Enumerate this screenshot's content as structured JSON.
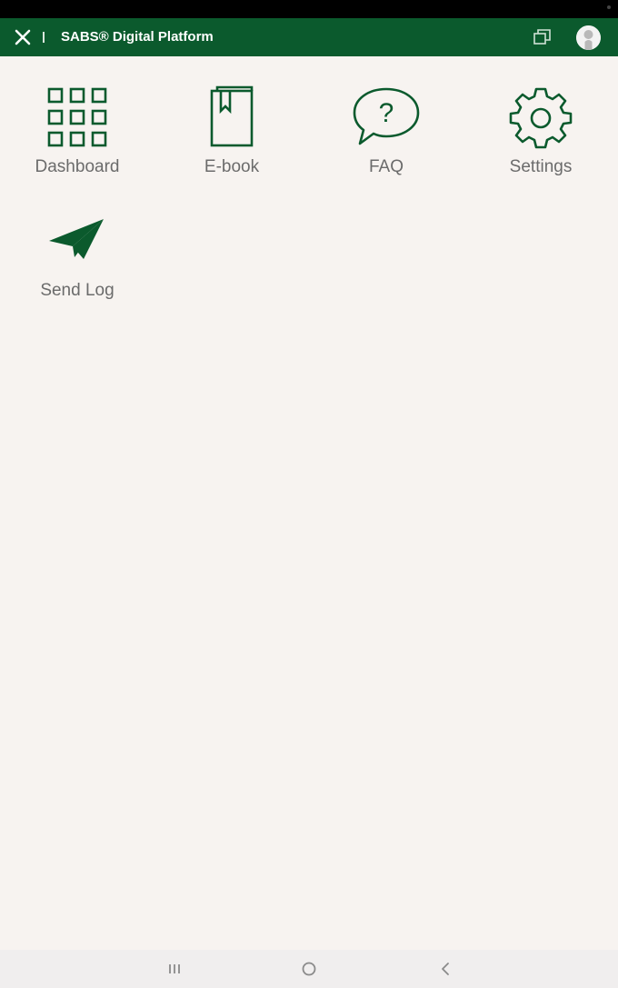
{
  "app_bar": {
    "title": "SABS® Digital Platform",
    "close_icon": "close-icon",
    "windows_icon": "copy-windows-icon",
    "avatar_icon": "user-avatar-icon"
  },
  "menu": {
    "items": [
      {
        "label": "Dashboard",
        "icon": "grid-icon"
      },
      {
        "label": "E-book",
        "icon": "book-icon"
      },
      {
        "label": "FAQ",
        "icon": "question-bubble-icon"
      },
      {
        "label": "Settings",
        "icon": "gear-icon"
      },
      {
        "label": "Send Log",
        "icon": "paper-plane-icon"
      }
    ]
  },
  "nav_bar": {
    "recents_icon": "recents-icon",
    "home_icon": "home-icon",
    "back_icon": "back-icon"
  },
  "colors": {
    "brand": "#0b5a2d",
    "background": "#f7f3f0",
    "label": "#6b6b6b"
  }
}
